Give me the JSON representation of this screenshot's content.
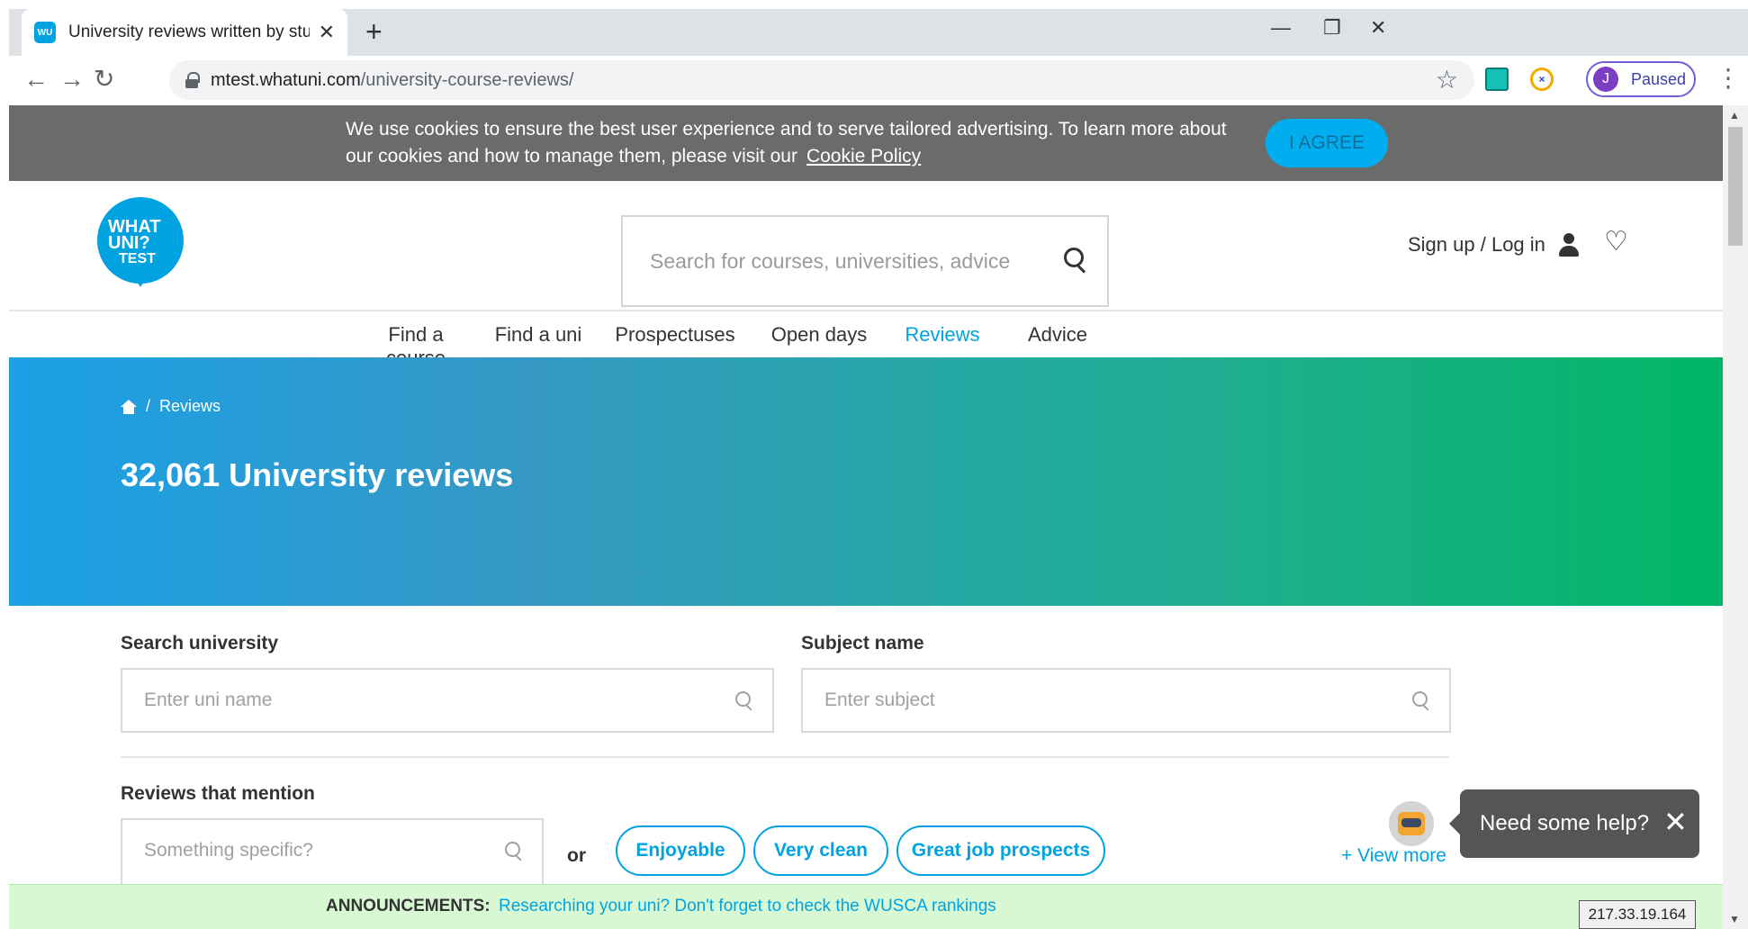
{
  "browser": {
    "tab_title": "University reviews written by stuc",
    "favicon_text": "WU",
    "new_tab_label": "+",
    "url_domain": "mtest.whatuni.com",
    "url_path": "/university-course-reviews/",
    "profile_initial": "J",
    "profile_status": "Paused",
    "icons": [
      "back-arrow-icon",
      "forward-arrow-icon",
      "reload-icon",
      "lock-icon",
      "star-icon",
      "menu-dots-icon"
    ]
  },
  "cookie": {
    "text": "We use cookies to ensure the best user experience and to serve tailored advertising. To learn more about our cookies and how to manage them, please visit our",
    "link": "Cookie Policy",
    "agree": "I AGREE"
  },
  "header": {
    "logo_line1": "WHAT",
    "logo_line2": "UNI?",
    "logo_line3": "TEST",
    "search_placeholder": "Search for courses, universities, advice",
    "signup": "Sign up / Log in"
  },
  "nav": {
    "items": [
      "Find a course",
      "Find a uni",
      "Prospectuses",
      "Open days",
      "Reviews",
      "Advice"
    ],
    "active": "Reviews"
  },
  "hero": {
    "breadcrumb_sep": "/",
    "breadcrumb": "Reviews",
    "title": "32,061 University reviews"
  },
  "filters": {
    "uni_label": "Search university",
    "uni_placeholder": "Enter uni name",
    "subject_label": "Subject name",
    "subject_placeholder": "Enter subject",
    "mention_label": "Reviews that mention",
    "mention_placeholder": "Something specific?",
    "or": "or",
    "pills": [
      "Enjoyable",
      "Very clean",
      "Great job prospects"
    ],
    "view_more": "+ View more"
  },
  "help": {
    "text": "Need some help?"
  },
  "announcement": {
    "label": "ANNOUNCEMENTS:",
    "link": "Researching your uni? Don't forget to check the WUSCA rankings"
  },
  "ip": "217.33.19.164",
  "colors": {
    "brand": "#00a3e0",
    "cookie_bar": "#6b6b6b",
    "announcement_bg": "#d8f8d4"
  }
}
